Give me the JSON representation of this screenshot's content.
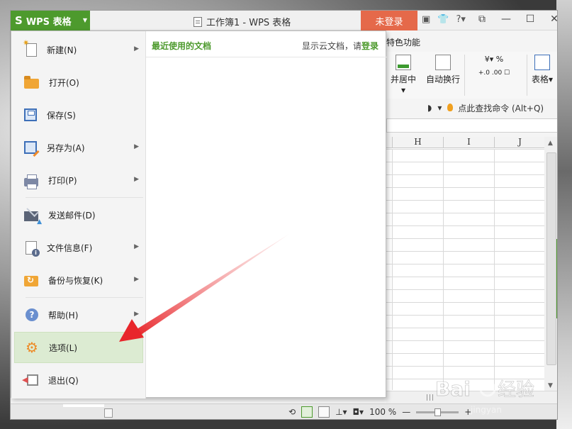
{
  "app": {
    "button_label": "WPS 表格",
    "window_title": "工作簿1 - WPS 表格",
    "login_button": "未登录",
    "accent_color": "#4d9a2d",
    "login_color": "#e5694a"
  },
  "ribbon": {
    "tab_label": "特色功能",
    "merge_label": "并居中",
    "wrap_label": "自动换行",
    "table_style_label": "表格",
    "percent_symbol": "%",
    "command_search": "点此查找命令 (Alt+Q)"
  },
  "sheet": {
    "columns": [
      "H",
      "I",
      "J"
    ]
  },
  "menu": {
    "items": [
      {
        "label": "新建(N)",
        "icon": "new-document-icon",
        "has_submenu": true
      },
      {
        "label": "打开(O)",
        "icon": "open-folder-icon",
        "has_submenu": false
      },
      {
        "label": "保存(S)",
        "icon": "save-icon",
        "has_submenu": false
      },
      {
        "label": "另存为(A)",
        "icon": "save-as-icon",
        "has_submenu": true
      },
      {
        "label": "打印(P)",
        "icon": "print-icon",
        "has_submenu": true
      },
      {
        "label": "发送邮件(D)",
        "icon": "send-mail-icon",
        "has_submenu": false
      },
      {
        "label": "文件信息(F)",
        "icon": "file-info-icon",
        "has_submenu": true
      },
      {
        "label": "备份与恢复(K)",
        "icon": "backup-restore-icon",
        "has_submenu": true
      },
      {
        "label": "帮助(H)",
        "icon": "help-icon",
        "has_submenu": true
      },
      {
        "label": "选项(L)",
        "icon": "gear-icon",
        "has_submenu": false,
        "highlighted": true
      },
      {
        "label": "退出(Q)",
        "icon": "exit-icon",
        "has_submenu": false
      }
    ],
    "recent_title": "最近使用的文档",
    "cloud_hint_prefix": "显示云文档，请",
    "cloud_hint_link": "登录"
  },
  "status": {
    "zoom": "100 %"
  }
}
